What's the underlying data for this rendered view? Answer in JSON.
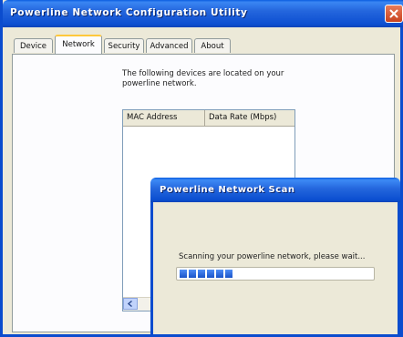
{
  "window": {
    "title": "Powerline Network Configuration Utility",
    "close_icon": "close-icon"
  },
  "tabs": [
    {
      "label": "Device",
      "active": false
    },
    {
      "label": "Network",
      "active": true
    },
    {
      "label": "Security",
      "active": false
    },
    {
      "label": "Advanced",
      "active": false
    },
    {
      "label": "About",
      "active": false
    }
  ],
  "network": {
    "description": "The following devices are located on your powerline network.",
    "columns": [
      "MAC Address",
      "Data Rate (Mbps)"
    ],
    "rows": []
  },
  "scan_dialog": {
    "title": "Powerline Network Scan",
    "message": "Scanning your powerline network, please wait...",
    "progress_fraction": 0.28,
    "progress_color": "#2e6fe6"
  },
  "colors": {
    "titlebar": "#0b4cce",
    "window_bg": "#ece9d8"
  }
}
